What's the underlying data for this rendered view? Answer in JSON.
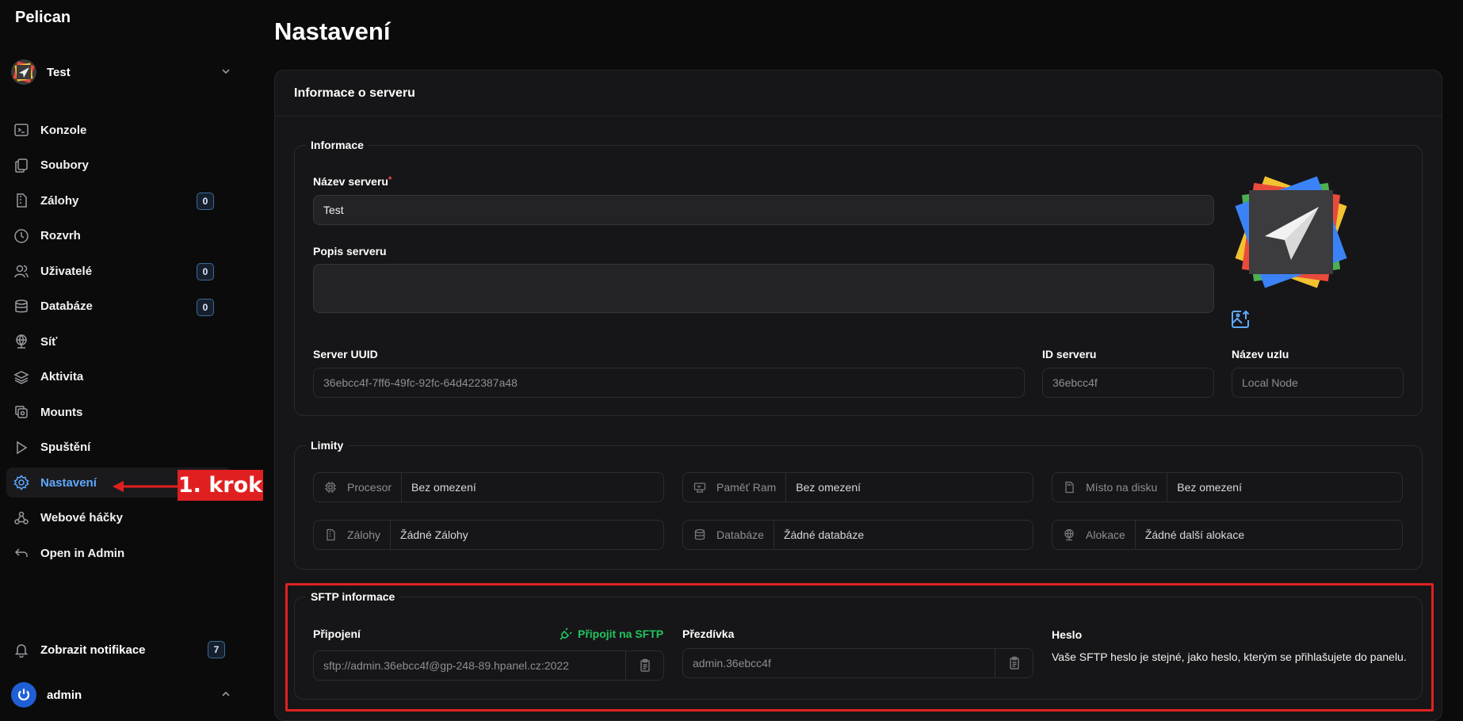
{
  "app": {
    "brand": "Pelican",
    "page_title": "Nastavení"
  },
  "server_switcher": {
    "name": "Test"
  },
  "nav": [
    {
      "label": "Konzole",
      "icon": "terminal-icon"
    },
    {
      "label": "Soubory",
      "icon": "files-icon"
    },
    {
      "label": "Zálohy",
      "icon": "archive-icon",
      "badge": "0"
    },
    {
      "label": "Rozvrh",
      "icon": "clock-icon"
    },
    {
      "label": "Uživatelé",
      "icon": "users-icon",
      "badge": "0"
    },
    {
      "label": "Databáze",
      "icon": "database-icon",
      "badge": "0"
    },
    {
      "label": "Síť",
      "icon": "network-icon"
    },
    {
      "label": "Aktivita",
      "icon": "stack-icon"
    },
    {
      "label": "Mounts",
      "icon": "mounts-icon"
    },
    {
      "label": "Spuštění",
      "icon": "play-icon"
    },
    {
      "label": "Nastavení",
      "icon": "gear-icon",
      "active": true
    },
    {
      "label": "Webové háčky",
      "icon": "webhook-icon"
    },
    {
      "label": "Open in Admin",
      "icon": "arrow-back-icon"
    }
  ],
  "annotation": {
    "label": "1. krok",
    "color": "#e02020"
  },
  "notifications": {
    "label": "Zobrazit notifikace",
    "count": "7"
  },
  "user": {
    "name": "admin"
  },
  "card": {
    "title": "Informace o serveru",
    "info": {
      "legend": "Informace",
      "name_label": "Název serveru",
      "name_required": "*",
      "name_value": "Test",
      "desc_label": "Popis serveru",
      "desc_value": "",
      "uuid_label": "Server UUID",
      "uuid_value": "36ebcc4f-7ff6-49fc-92fc-64d422387a48",
      "id_label": "ID serveru",
      "id_value": "36ebcc4f",
      "node_label": "Název uzlu",
      "node_value": "Local Node"
    },
    "limits": {
      "legend": "Limity",
      "items": [
        {
          "label": "Procesor",
          "value": "Bez omezení",
          "icon": "cpu-icon"
        },
        {
          "label": "Paměť Ram",
          "value": "Bez omezení",
          "icon": "memory-icon"
        },
        {
          "label": "Místo na disku",
          "value": "Bez omezení",
          "icon": "disk-icon"
        },
        {
          "label": "Zálohy",
          "value": "Žádné Zálohy",
          "icon": "archive-icon"
        },
        {
          "label": "Databáze",
          "value": "Žádné databáze",
          "icon": "database-icon"
        },
        {
          "label": "Alokace",
          "value": "Žádné další alokace",
          "icon": "network-icon"
        }
      ]
    },
    "sftp": {
      "legend": "SFTP informace",
      "connection_label": "Připojení",
      "connect_link": "Připojit na SFTP",
      "connection_value": "sftp://admin.36ebcc4f@gp-248-89.hpanel.cz:2022",
      "username_label": "Přezdívka",
      "username_value": "admin.36ebcc4f",
      "password_label": "Heslo",
      "password_text": "Vaše SFTP heslo je stejné, jako heslo, kterým se přihlašujete do panelu."
    }
  },
  "colors": {
    "accent": "#5ea9ff",
    "success": "#22c55e",
    "highlight": "#e02020",
    "background": "#0b0b0c",
    "card": "#161618"
  }
}
